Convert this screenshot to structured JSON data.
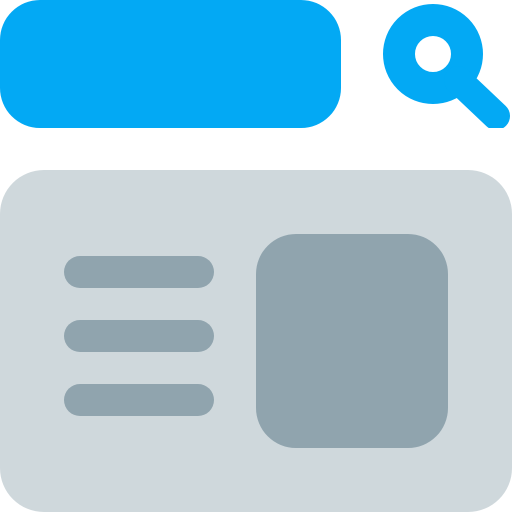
{
  "colors": {
    "accent": "#03A9F4",
    "card_background": "#CFD8DC",
    "placeholder": "#90A4AE",
    "background": "#FFFFFF"
  },
  "icons": {
    "search": "search-icon"
  },
  "content": {
    "text_lines_count": 3
  }
}
